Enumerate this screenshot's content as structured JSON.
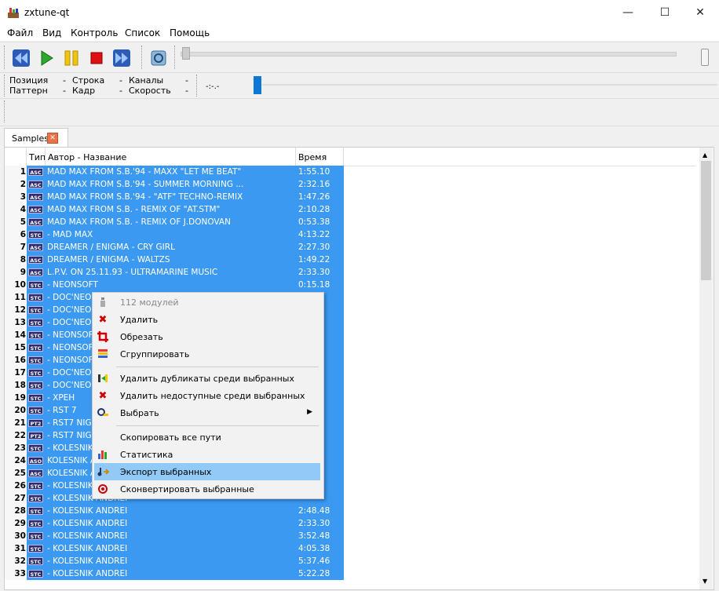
{
  "window": {
    "title": "zxtune-qt",
    "minimize": "—",
    "maximize": "☐",
    "close": "✕"
  },
  "menu": [
    "Файл",
    "Вид",
    "Контроль",
    "Список",
    "Помощь"
  ],
  "info": {
    "position_label": "Позиция",
    "position_value": "-",
    "line_label": "Строка",
    "line_value": "-",
    "channels_label": "Каналы",
    "channels_value": "-",
    "pattern_label": "Паттерн",
    "pattern_value": "-",
    "frame_label": "Кадр",
    "frame_value": "-",
    "speed_label": "Скорость",
    "speed_value": "-",
    "time": "-:-.-"
  },
  "tab": {
    "label": "Samples"
  },
  "columns": {
    "type": "Тип",
    "title": "Автор - Название",
    "time": "Время"
  },
  "rows": [
    {
      "n": "1",
      "type": "ASC",
      "title": "MAD MAX FROM S.B.'94 - MAXX \"LET ME BEAT\"",
      "time": "1:55.10"
    },
    {
      "n": "2",
      "type": "ASC",
      "title": "MAD MAX FROM S.B.'94 - SUMMER MORNING ...",
      "time": "2:32.16"
    },
    {
      "n": "3",
      "type": "ASC",
      "title": "MAD MAX FROM S.B.'94 - \"ATF\" TECHNO-REMIX",
      "time": "1:47.26"
    },
    {
      "n": "4",
      "type": "ASC",
      "title": "MAD MAX FROM S.B. - REMIX OF \"AT.STM\"",
      "time": "2:10.28"
    },
    {
      "n": "5",
      "type": "ASC",
      "title": "MAD MAX FROM S.B. - REMIX OF J.DONOVAN",
      "time": "0:53.38"
    },
    {
      "n": "6",
      "type": "STC",
      "title": " - MAD MAX",
      "time": "4:13.22"
    },
    {
      "n": "7",
      "type": "ASC",
      "title": "DREAMER / ENIGMA - CRY GIRL",
      "time": "2:27.30"
    },
    {
      "n": "8",
      "type": "ASC",
      "title": "DREAMER / ENIGMA - WALTZS",
      "time": "1:49.22"
    },
    {
      "n": "9",
      "type": "ASC",
      "title": "L.P.V.  ON 25.11.93 - ULTRAMARINE MUSIC",
      "time": "2:33.30"
    },
    {
      "n": "10",
      "type": "STC",
      "title": " - NEONSOFT",
      "time": "0:15.18"
    },
    {
      "n": "11",
      "type": "STC",
      "title": " - DOC'NEON",
      "time": ""
    },
    {
      "n": "12",
      "type": "STC",
      "title": " - DOC'NEON",
      "time": ""
    },
    {
      "n": "13",
      "type": "STC",
      "title": " - DOC'NEON",
      "time": ""
    },
    {
      "n": "14",
      "type": "STC",
      "title": " - NEONSOFT",
      "time": ""
    },
    {
      "n": "15",
      "type": "STC",
      "title": " - NEONSOFT",
      "time": ""
    },
    {
      "n": "16",
      "type": "STC",
      "title": " - NEONSOFT",
      "time": ""
    },
    {
      "n": "17",
      "type": "STC",
      "title": " - DOC'NEON",
      "time": ""
    },
    {
      "n": "18",
      "type": "STC",
      "title": " - DOC'NEON",
      "time": ""
    },
    {
      "n": "19",
      "type": "STC",
      "title": " - XPEH",
      "time": ""
    },
    {
      "n": "20",
      "type": "STC",
      "title": " - RST 7",
      "time": ""
    },
    {
      "n": "21",
      "type": "PT2",
      "title": " - RST7 NIG",
      "time": ""
    },
    {
      "n": "22",
      "type": "PT2",
      "title": " - RST7 NIG",
      "time": ""
    },
    {
      "n": "23",
      "type": "STC",
      "title": " - KOLESNIK",
      "time": ""
    },
    {
      "n": "24",
      "type": "ASO",
      "title": "KOLESNIK A",
      "time": ""
    },
    {
      "n": "25",
      "type": "ASC",
      "title": "KOLESNIK A",
      "time": ""
    },
    {
      "n": "26",
      "type": "STC",
      "title": " - KOLESNIK",
      "time": ""
    },
    {
      "n": "27",
      "type": "STC",
      "title": " - KOLESNIK ANDREI",
      "time": ""
    },
    {
      "n": "28",
      "type": "STC",
      "title": " - KOLESNIK ANDREI",
      "time": "2:48.48"
    },
    {
      "n": "29",
      "type": "STC",
      "title": " - KOLESNIK ANDREI",
      "time": "2:33.30"
    },
    {
      "n": "30",
      "type": "STC",
      "title": " - KOLESNIK ANDREI",
      "time": "3:52.48"
    },
    {
      "n": "31",
      "type": "STC",
      "title": " - KOLESNIK ANDREI",
      "time": "4:05.38"
    },
    {
      "n": "32",
      "type": "STC",
      "title": " - KOLESNIK ANDREI",
      "time": "5:37.46"
    },
    {
      "n": "33",
      "type": "STC",
      "title": " - KOLESNIK ANDREI",
      "time": "5:22.28"
    }
  ],
  "context_menu": [
    {
      "label": "112 модулей",
      "icon": "info-icon",
      "disabled": true
    },
    {
      "label": "Удалить",
      "icon": "delete-icon"
    },
    {
      "label": "Обрезать",
      "icon": "crop-icon"
    },
    {
      "label": "Сгруппировать",
      "icon": "group-icon"
    },
    {
      "label": "Удалить дубликаты среди выбранных",
      "icon": "remove-duplicates-icon"
    },
    {
      "label": "Удалить недоступные среди выбранных",
      "icon": "remove-unavailable-icon"
    },
    {
      "label": "Выбрать",
      "icon": "select-icon",
      "submenu": true
    },
    {
      "label": "Скопировать все пути",
      "icon": ""
    },
    {
      "label": "Статистика",
      "icon": "statistics-icon"
    },
    {
      "label": "Экспорт выбранных",
      "icon": "export-icon",
      "highlighted": true
    },
    {
      "label": "Сконвертировать выбранные",
      "icon": "convert-icon"
    }
  ],
  "colors": {
    "selection": "#3b99f1",
    "menu_highlight": "#91c9f7",
    "accent": "#0a78d7"
  }
}
